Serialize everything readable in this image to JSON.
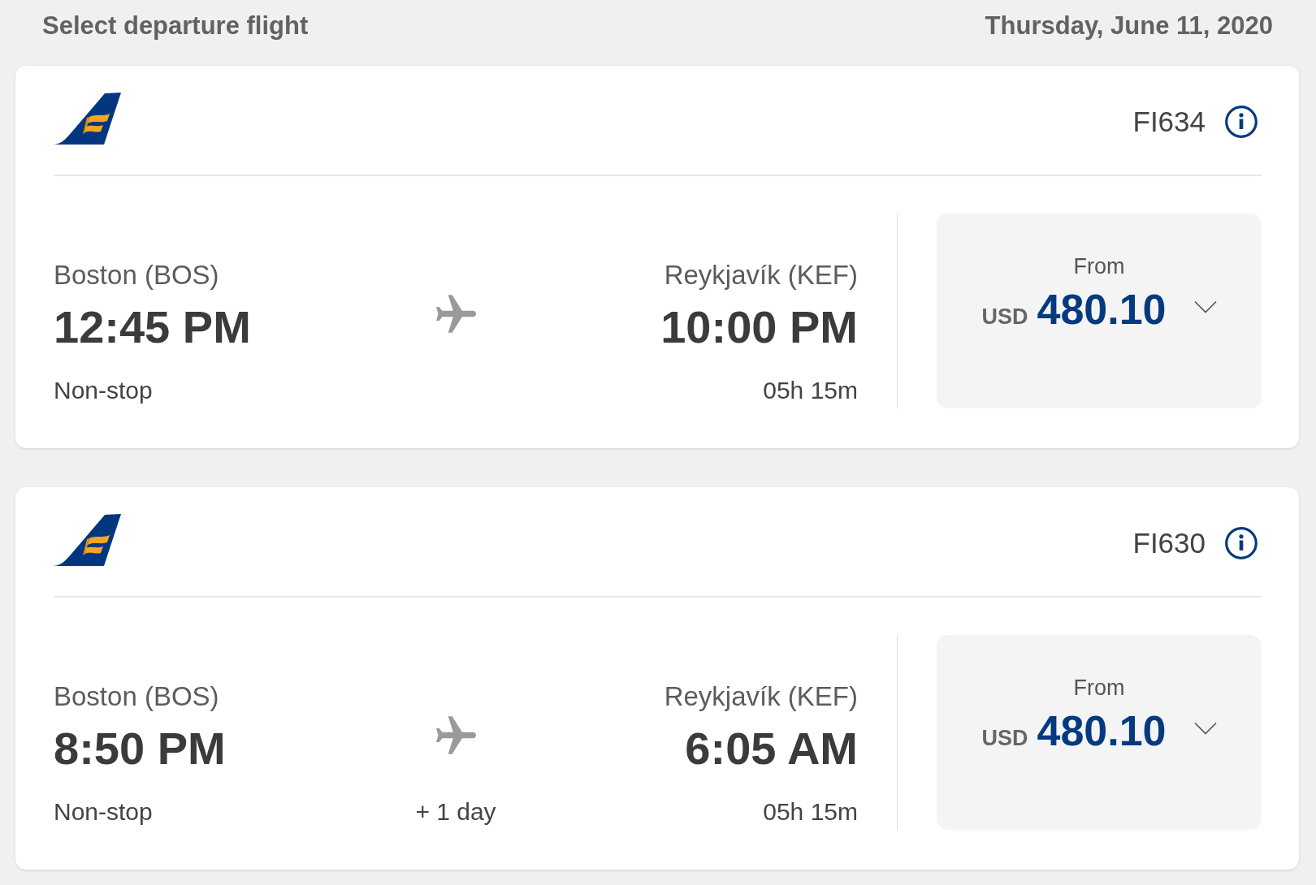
{
  "header": {
    "title": "Select departure flight",
    "date": "Thursday, June 11, 2020"
  },
  "flights": [
    {
      "flight_number": "FI634",
      "origin": "Boston (BOS)",
      "departure_time": "12:45 PM",
      "stops": "Non-stop",
      "destination": "Reykjavík (KEF)",
      "arrival_time": "10:00 PM",
      "duration": "05h 15m",
      "fare": {
        "label": "From",
        "currency": "USD",
        "amount": "480.10",
        "expanded": false
      }
    },
    {
      "flight_number": "FI630",
      "origin": "Boston (BOS)",
      "departure_time": "8:50 PM",
      "stops": "Non-stop",
      "day_offset": "+ 1 day",
      "destination": "Reykjavík (KEF)",
      "arrival_time": "6:05 AM",
      "duration": "05h 15m",
      "fare": {
        "label": "From",
        "currency": "USD",
        "amount": "480.10",
        "expanded": false
      }
    }
  ]
}
